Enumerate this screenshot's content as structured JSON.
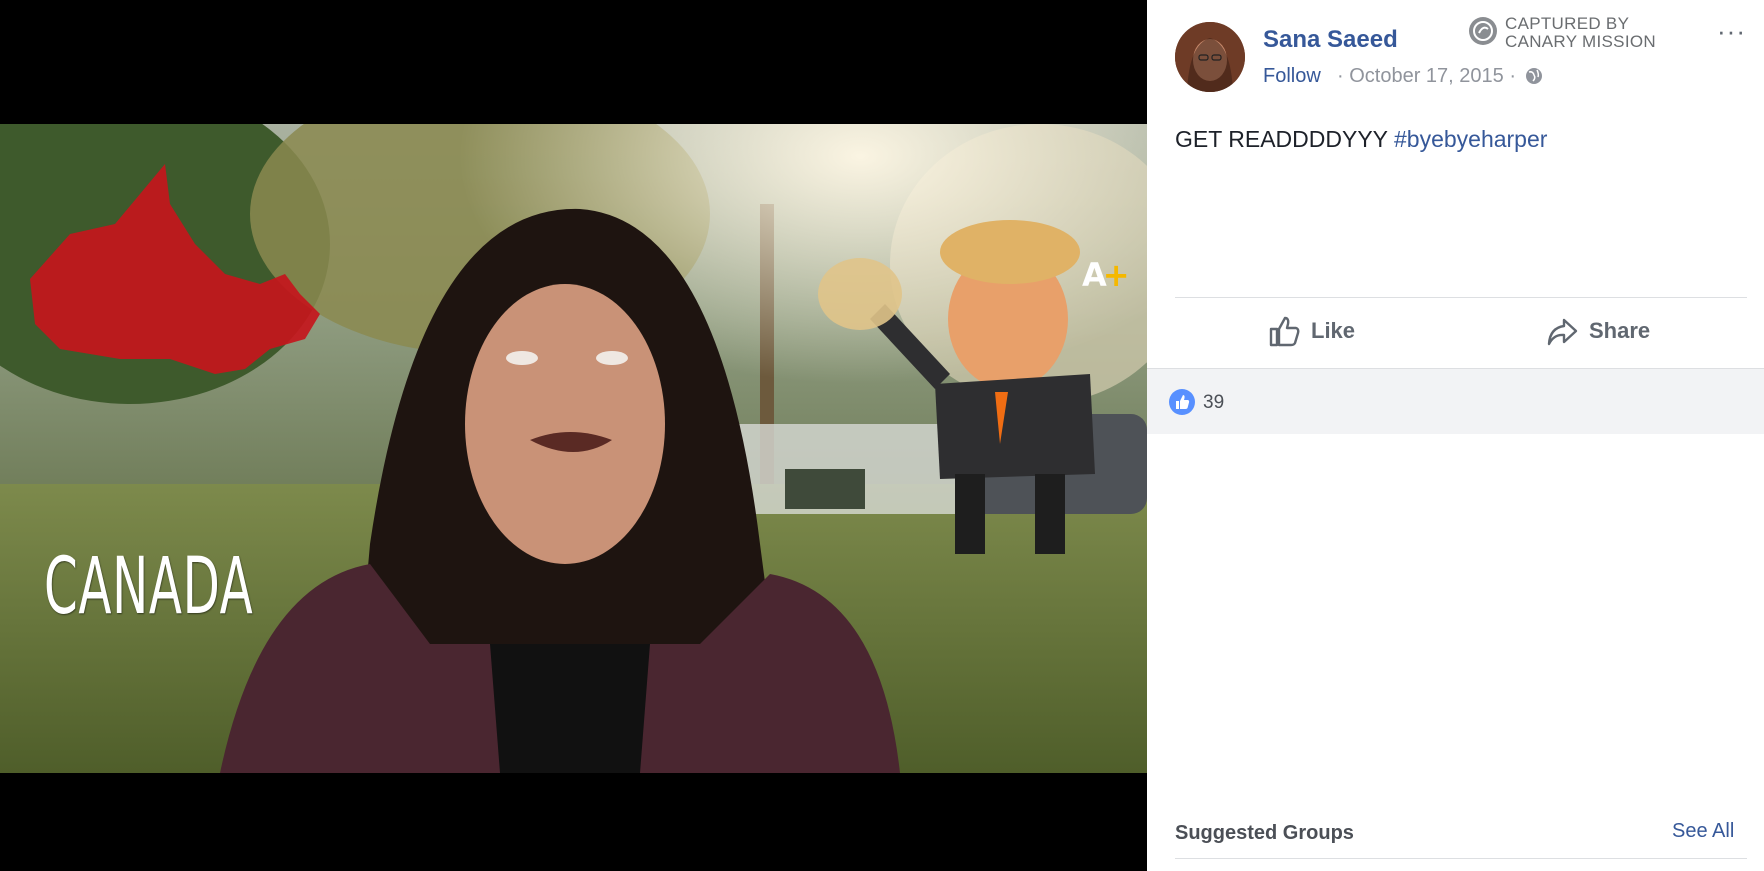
{
  "video": {
    "overlay_text": "CANADA",
    "brand_logo_a": "A",
    "brand_logo_plus": "+"
  },
  "post": {
    "author_name": "Sana Saeed",
    "follow_label": "Follow",
    "date": "October 17, 2015",
    "separator": "·",
    "text": "GET READDDDYYY",
    "hashtag": "#byebyeharper",
    "more_label": "···",
    "like_label": "Like",
    "share_label": "Share",
    "like_count": "39"
  },
  "watermark": {
    "line1": "CAPTURED BY",
    "line2": "CANARY MISSION"
  },
  "sidebar": {
    "suggested_title": "Suggested Groups",
    "see_all_label": "See All"
  },
  "colors": {
    "link": "#365899",
    "reaction_blue": "#5890ff",
    "canada_red": "#c4161c"
  }
}
